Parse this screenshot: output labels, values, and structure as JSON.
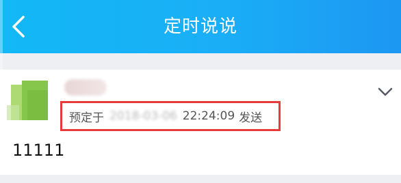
{
  "header": {
    "title": "定时说说",
    "back_icon": "chevron-left-icon"
  },
  "post": {
    "author_name": "",
    "schedule_prefix": "预定于",
    "schedule_date": "2018-03-06",
    "schedule_time": "22:24:09",
    "schedule_suffix": "发送",
    "content": "11111",
    "menu_icon": "chevron-down-icon"
  },
  "colors": {
    "header_gradient_start": "#13b8f5",
    "header_gradient_end": "#1d97f2",
    "highlight_border": "#e83a3a",
    "page_background": "#eeeff3"
  }
}
